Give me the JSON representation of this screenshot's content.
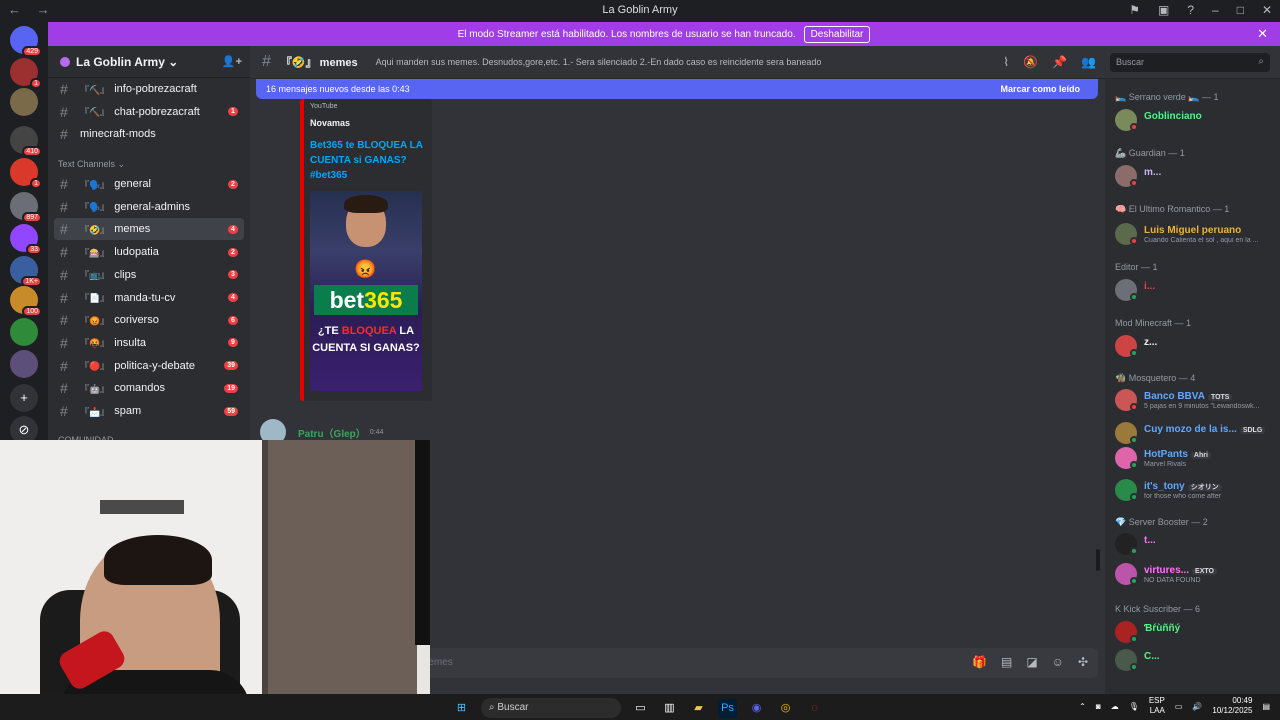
{
  "window": {
    "title": "La Goblin Army",
    "nav_back": "←",
    "nav_fwd": "→"
  },
  "streamer_banner": {
    "text": "El modo Streamer está habilitado. Los nombres de usuario se han truncado.",
    "button": "Deshabilitar",
    "close": "✕"
  },
  "servers": [
    {
      "badge": "429",
      "color": "#5865f2"
    },
    {
      "badge": "1",
      "color": "#9c2f2f"
    },
    {
      "badge": "",
      "color": "#7a6a4a"
    },
    {
      "badge": "410",
      "color": "#444"
    },
    {
      "badge": "1",
      "color": "#d8392b"
    },
    {
      "badge": "897",
      "color": "#6b6e76"
    },
    {
      "badge": "33",
      "color": "#9146ff"
    },
    {
      "badge": "1K+",
      "color": "#3a5fa0"
    },
    {
      "badge": "100",
      "color": "#c88b2a"
    },
    {
      "badge": "",
      "color": "#2f8a3a"
    },
    {
      "badge": "",
      "color": "#5c4f7a"
    }
  ],
  "guild": {
    "name": "La Goblin Army ⌄"
  },
  "channels_top": [
    {
      "emoji": "『⛏️』",
      "name": "info-pobrezacraft",
      "count": ""
    },
    {
      "emoji": "『⛏️』",
      "name": "chat-pobrezacraft",
      "count": "1"
    },
    {
      "emoji": "",
      "name": "minecraft-mods",
      "count": ""
    }
  ],
  "category": "Text Channels ⌄",
  "channels": [
    {
      "emoji": "『🗣️』",
      "name": "general",
      "count": "2"
    },
    {
      "emoji": "『🗣️』",
      "name": "general-admins",
      "count": ""
    },
    {
      "emoji": "『🤣』",
      "name": "memes",
      "count": "4"
    },
    {
      "emoji": "『🎰』",
      "name": "ludopatia",
      "count": "2"
    },
    {
      "emoji": "『📺』",
      "name": "clips",
      "count": "3"
    },
    {
      "emoji": "『📄』",
      "name": "manda-tu-cv",
      "count": "4"
    },
    {
      "emoji": "『😡』",
      "name": "coriverso",
      "count": "6"
    },
    {
      "emoji": "『🤬』",
      "name": "insulta",
      "count": "9"
    },
    {
      "emoji": "『🔴』",
      "name": "politica-y-debate",
      "count": "39"
    },
    {
      "emoji": "『🤖』",
      "name": "comandos",
      "count": "19"
    },
    {
      "emoji": "『📩』",
      "name": "spam",
      "count": "59"
    }
  ],
  "category2": "COMUNIDAD",
  "topbar": {
    "channel_emoji": "『🤣』",
    "channel_name": "memes",
    "topic": "Aqui manden sus memes. Desnudos,gore,etc. 1.- Sera silenciado 2.-En dado caso es reincidente sera baneado",
    "search_placeholder": "Buscar"
  },
  "new_messages": {
    "text": "16 mensajes nuevos desde las 0:43",
    "mark": "Marcar como leído"
  },
  "embed": {
    "provider": "YouTube",
    "author": "Novamas",
    "title": "Bet365 te BLOQUEA LA CUENTA si GANAS? #bet365",
    "thumb_logo_a": "bet",
    "thumb_logo_b": "365",
    "thumb_caption_a": "¿TE ",
    "thumb_caption_b": "BLOQUEA",
    "thumb_caption_c": " LA CUENTA SI GANAS?"
  },
  "message2": {
    "username": "Patru（Glep）",
    "time": "0:44"
  },
  "composer": {
    "placeholder": "memes"
  },
  "members": {
    "roles": [
      {
        "name": "🛌 Serrano verde 🛌 — 1"
      },
      {
        "name": "🦾 Guardian — 1"
      },
      {
        "name": "🧠 El Ultimo Romantico — 1"
      },
      {
        "name": "Editor — 1"
      },
      {
        "name": "Mod Minecraft — 1"
      },
      {
        "name": "🧌 Mosquetero — 4"
      },
      {
        "name": "💎 Server Booster — 2"
      },
      {
        "name": "K Kick Suscriber — 6"
      }
    ],
    "list": [
      {
        "name": "Goblinciano",
        "color": "#57f287",
        "sub": "",
        "tag": ""
      },
      {
        "name": "m...",
        "color": "#c9b1f0",
        "sub": "",
        "tag": ""
      },
      {
        "name": "Luis Miguel peruano",
        "color": "#f0b232",
        "sub": "Cuando Calienta el sol , aqui en la ...",
        "tag": ""
      },
      {
        "name": "i...",
        "color": "#f23f43",
        "sub": "",
        "tag": ""
      },
      {
        "name": "z...",
        "color": "#f2f3f5",
        "sub": "",
        "tag": ""
      },
      {
        "name": "Banco BBVA",
        "color": "#5fa8ff",
        "sub": "5 pajas en 9 minutos \"Lewandoswk...",
        "tag": "TOTS"
      },
      {
        "name": "Cuy mozo de la is...",
        "color": "#5fa8ff",
        "sub": "",
        "tag": "SDLG"
      },
      {
        "name": "HotPants",
        "color": "#5fa8ff",
        "sub": "Marvel Rivals",
        "tag": "Ahri"
      },
      {
        "name": "it's_tony",
        "color": "#5fa8ff",
        "sub": "for those who come after",
        "tag": "シオリン"
      },
      {
        "name": "t...",
        "color": "#ff73fa",
        "sub": "",
        "tag": ""
      },
      {
        "name": "virtures...",
        "color": "#ff73fa",
        "sub": "NO DATA FOUND",
        "tag": "EXTO"
      },
      {
        "name": "Ɓŕùññý",
        "color": "#57f287",
        "sub": "",
        "tag": ""
      },
      {
        "name": "C...",
        "color": "#57f287",
        "sub": "",
        "tag": ""
      }
    ]
  },
  "taskbar": {
    "search": "Buscar",
    "lang1": "ESP",
    "lang2": "LAA",
    "time": "00:49",
    "date": "10/12/2025"
  }
}
